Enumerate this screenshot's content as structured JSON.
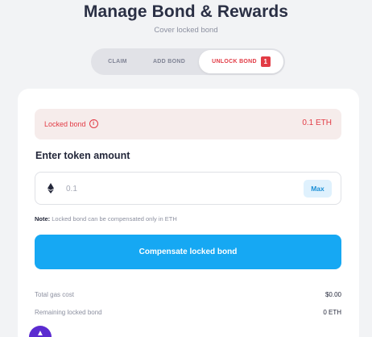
{
  "header": {
    "title": "Manage Bond & Rewards",
    "subtitle": "Cover locked bond"
  },
  "tabs": [
    {
      "label": "CLAIM",
      "active": false
    },
    {
      "label": "ADD BOND",
      "active": false
    },
    {
      "label": "UNLOCK BOND",
      "active": true,
      "badge": "1"
    }
  ],
  "locked": {
    "label": "Locked bond",
    "value": "0.1 ETH",
    "icon": "info-icon"
  },
  "amount": {
    "title": "Enter token amount",
    "token_icon": "ethereum-icon",
    "value": "",
    "placeholder": "0.1",
    "max_label": "Max"
  },
  "note": {
    "label": "Note:",
    "text": " Locked bond can be compensated only in ETH"
  },
  "action": {
    "label": "Compensate locked bond"
  },
  "summary": [
    {
      "label": "Total gas cost",
      "value": "$0.00"
    },
    {
      "label": "Remaining locked bond",
      "value": "0 ETH"
    }
  ],
  "colors": {
    "accent": "#16a8f3",
    "danger": "#e23b45",
    "background": "#f2f3f5"
  }
}
